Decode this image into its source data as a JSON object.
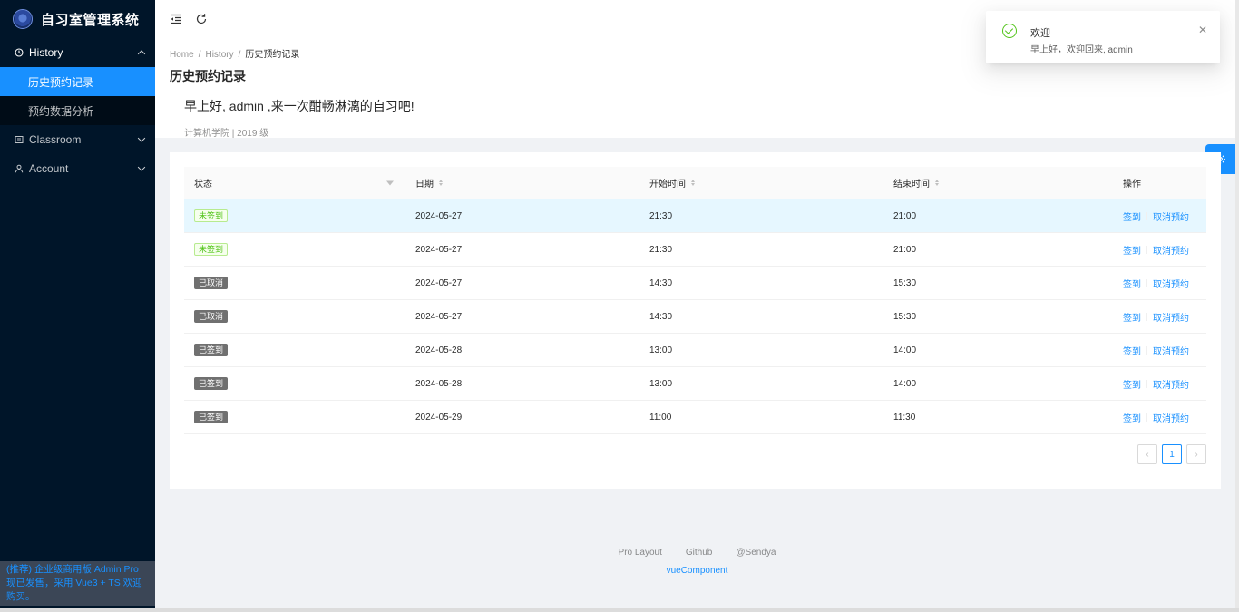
{
  "app": {
    "title": "自习室管理系统"
  },
  "sidebar": {
    "items": [
      {
        "label": "History",
        "icon": "history-icon",
        "expanded": true,
        "children": [
          {
            "label": "历史预约记录",
            "active": true
          },
          {
            "label": "预约数据分析",
            "active": false
          }
        ]
      },
      {
        "label": "Classroom",
        "icon": "classroom-icon",
        "expanded": false
      },
      {
        "label": "Account",
        "icon": "user-icon",
        "expanded": false
      }
    ],
    "promo": "(推荐) 企业级商用版 Admin Pro 现已发售，采用 Vue3 + TS 欢迎购买。"
  },
  "breadcrumb": [
    "Home",
    "History",
    "历史预约记录"
  ],
  "page": {
    "title": "历史预约记录",
    "greeting": "早上好, admin ,来一次酣畅淋漓的自习吧!",
    "subinfo": "计算机学院 | 2019 级"
  },
  "table": {
    "columns": [
      "状态",
      "日期",
      "开始时间",
      "结束时间",
      "操作"
    ],
    "rows": [
      {
        "status": "未签到",
        "status_type": "green",
        "date": "2024-05-27",
        "start": "21:30",
        "end": "21:00"
      },
      {
        "status": "未签到",
        "status_type": "green",
        "date": "2024-05-27",
        "start": "21:30",
        "end": "21:00"
      },
      {
        "status": "已取消",
        "status_type": "gray",
        "date": "2024-05-27",
        "start": "14:30",
        "end": "15:30"
      },
      {
        "status": "已取消",
        "status_type": "gray",
        "date": "2024-05-27",
        "start": "14:30",
        "end": "15:30"
      },
      {
        "status": "已签到",
        "status_type": "gray",
        "date": "2024-05-28",
        "start": "13:00",
        "end": "14:00"
      },
      {
        "status": "已签到",
        "status_type": "gray",
        "date": "2024-05-28",
        "start": "13:00",
        "end": "14:00"
      },
      {
        "status": "已签到",
        "status_type": "gray",
        "date": "2024-05-29",
        "start": "11:00",
        "end": "11:30"
      }
    ],
    "actions": {
      "checkin": "签到",
      "cancel": "取消预约"
    }
  },
  "pagination": {
    "current": "1"
  },
  "footer": {
    "links": [
      "Pro Layout",
      "Github",
      "@Sendya"
    ],
    "sub": "vueComponent"
  },
  "notification": {
    "title": "欢迎",
    "description": "早上好，欢迎回来, admin"
  },
  "colors": {
    "primary": "#1890ff",
    "sidebar_bg": "#001529",
    "success": "#52c41a"
  }
}
